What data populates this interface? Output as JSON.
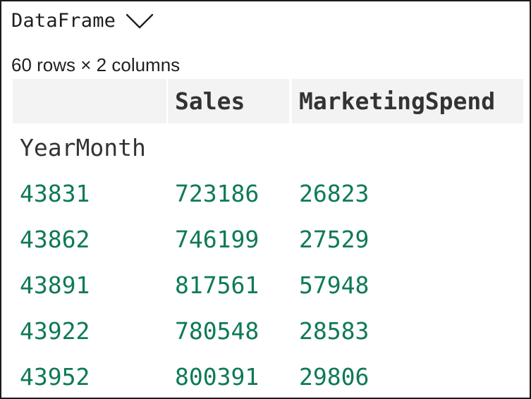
{
  "header": {
    "title": "DataFrame"
  },
  "shape_label": "60 rows × 2 columns",
  "table": {
    "index_name": "YearMonth",
    "columns": [
      "",
      "Sales",
      "MarketingSpend"
    ],
    "rows": [
      [
        "43831",
        "723186",
        "26823"
      ],
      [
        "43862",
        "746199",
        "27529"
      ],
      [
        "43891",
        "817561",
        "57948"
      ],
      [
        "43922",
        "780548",
        "28583"
      ],
      [
        "43952",
        "800391",
        "29806"
      ]
    ]
  },
  "colors": {
    "value_text": "#0e7a55",
    "header_bg": "#f3f3f3",
    "header_text": "#333333"
  },
  "icons": {
    "expand": "chevron-down-icon"
  }
}
